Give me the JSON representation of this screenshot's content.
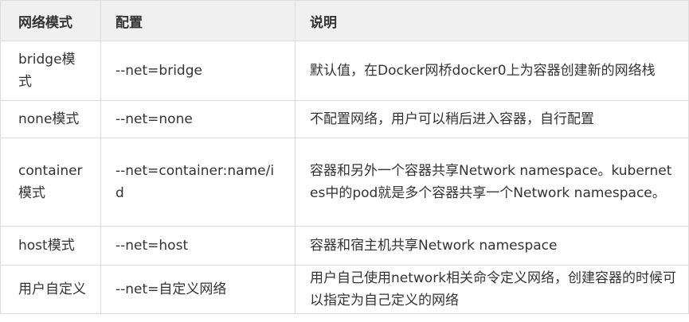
{
  "header": {
    "mode": "网络模式",
    "config": "配置",
    "desc": "说明"
  },
  "rows": [
    {
      "mode": "bridge模式",
      "config": "--net=bridge",
      "desc": "默认值，在Docker网桥docker0上为容器创建新的网络栈"
    },
    {
      "mode": "none模式",
      "config": "--net=none",
      "desc": "不配置网络，用户可以稍后进入容器，自行配置"
    },
    {
      "mode": "container模式",
      "config": "--net=container:name/id",
      "desc": "容器和另外一个容器共享Network namespace。kubernetes中的pod就是多个容器共享一个Network namespace。"
    },
    {
      "mode": "host模式",
      "config": "--net=host",
      "desc": "容器和宿主机共享Network namespace"
    },
    {
      "mode": "用户自定义",
      "config": "--net=自定义网络",
      "desc": "用户自己使用network相关命令定义网络，创建容器的时候可以指定为自己定义的网络"
    }
  ]
}
